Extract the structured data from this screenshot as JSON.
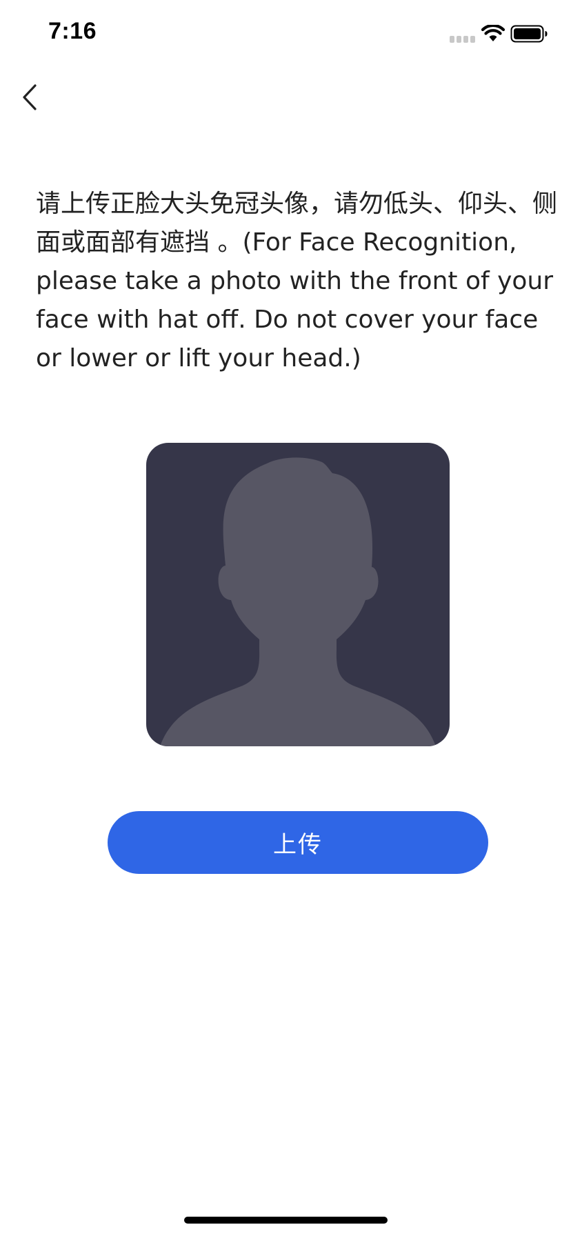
{
  "status_bar": {
    "time": "7:16"
  },
  "nav": {
    "back_icon": "chevron-left-icon"
  },
  "main": {
    "instructions": "请上传正脸大头免冠头像，请勿低头、仰头、侧面或面部有遮挡 。(For Face Recognition, please take a photo with the front of your face with hat off. Do not cover your face or lower or lift your head.)",
    "avatar_placeholder_icon": "person-silhouette-icon",
    "upload_label": "上传"
  },
  "colors": {
    "primary": "#2F66E6",
    "avatar_background": "#363649",
    "avatar_silhouette": "#575664",
    "text": "#222222"
  }
}
